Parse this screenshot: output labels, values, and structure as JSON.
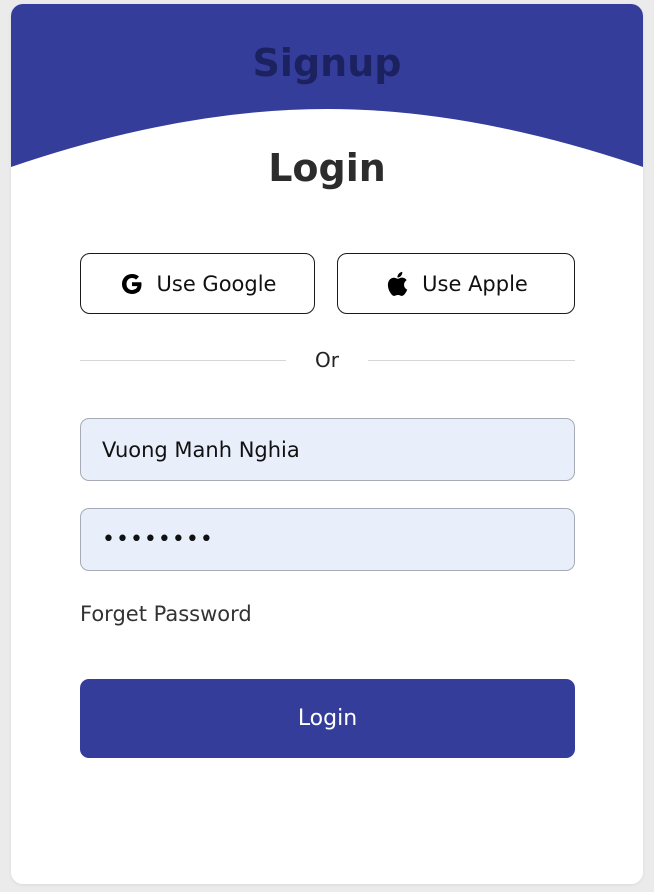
{
  "tabs": {
    "signup_label": "Signup"
  },
  "form": {
    "title": "Login",
    "google_label": "Use Google",
    "apple_label": "Use Apple",
    "divider_text": "Or",
    "username_value": "Vuong Manh Nghia",
    "password_value": "••••••••",
    "forget_label": "Forget Password",
    "submit_label": "Login"
  },
  "colors": {
    "brand": "#353d9b",
    "field_bg": "#e8effb"
  },
  "icons": {
    "google": "google-icon",
    "apple": "apple-icon"
  }
}
